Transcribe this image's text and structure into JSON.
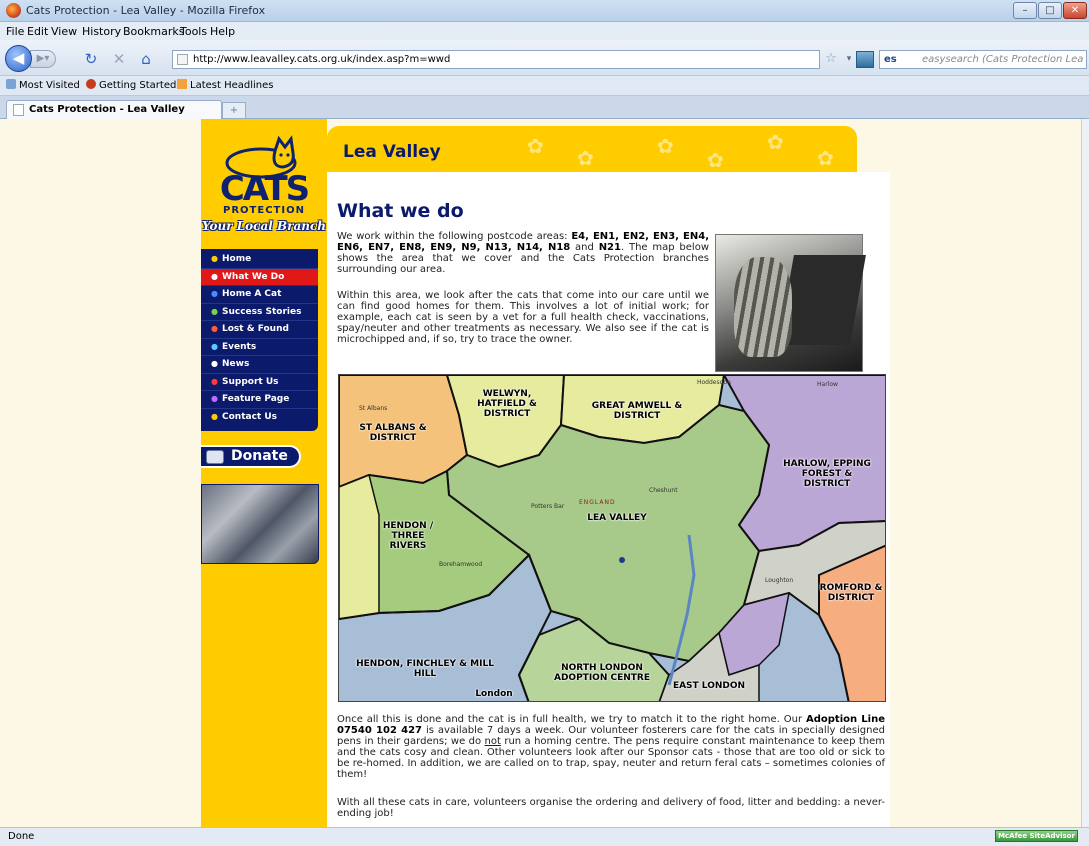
{
  "browser": {
    "window_title": "Cats Protection - Lea Valley - Mozilla Firefox",
    "menu": [
      "File",
      "Edit",
      "View",
      "History",
      "Bookmarks",
      "Tools",
      "Help"
    ],
    "url": "http://www.leavalley.cats.org.uk/index.asp?m=wwd",
    "search_placeholder": "easysearch (Cats Protection Lea Vall",
    "search_engine_label": "es",
    "bookmarks": [
      "Most Visited",
      "Getting Started",
      "Latest Headlines"
    ],
    "tab_title": "Cats Protection - Lea Valley",
    "new_tab": "+",
    "status": "Done",
    "addon": "McAfee SiteAdvisor"
  },
  "site": {
    "logo_text": "CATS",
    "logo_sub": "PROTECTION",
    "logo_tagline": "Your Local Branch",
    "banner_title": "Lea Valley",
    "nav": [
      "Home",
      "What We Do",
      "Home A Cat",
      "Success Stories",
      "Lost & Found",
      "Events",
      "News",
      "Support Us",
      "Feature Page",
      "Contact Us"
    ],
    "nav_active_index": 1,
    "donate_label": "Donate"
  },
  "content": {
    "heading": "What we do",
    "p1_a": "We work within the following postcode areas: ",
    "p1_codes": "E4, EN1, EN2, EN3, EN4, EN6, EN7, EN8, EN9, N9, N13, N14, N18",
    "p1_and": " and ",
    "p1_last": "N21",
    "p1_b": ". The map below shows the area that we cover and the Cats Protection branches surrounding our area.",
    "p2": "Within this area, we look after the cats that come into our care until we can find good homes for them. This involves a lot of initial work; for example, each cat is seen by a vet for a full health check, vaccinations, spay/neuter and other treatments as necessary. We also see if the cat is microchipped and, if so, try to trace the owner.",
    "p3_a": "Once all this is done and the cat is in full health, we try to match it to the right home. Our ",
    "p3_bold": "Adoption Line 07540 102 427",
    "p3_b": " is available 7 days a week. Our volunteer fosterers care for the cats in specially designed pens in their gardens; we do ",
    "p3_not": "not",
    "p3_c": " run a homing centre. The pens require constant maintenance to keep them and the cats cosy and clean. Other volunteers look after our Sponsor cats - those that are too old or sick to be re-homed. In addition, we are called on to trap, spay, neuter and return feral cats – sometimes colonies of them!",
    "p4": "With all these cats in care, volunteers organise the ordering and delivery of food, litter and bedding: a never-ending job!"
  },
  "map": {
    "regions": {
      "st_albans": "ST ALBANS & DISTRICT",
      "welwyn": "WELWYN, HATFIELD & DISTRICT",
      "great_amwell": "GREAT AMWELL & DISTRICT",
      "harlow": "HARLOW, EPPING FOREST & DISTRICT",
      "lea_valley": "LEA VALLEY",
      "hendon_three": "HENDON / THREE RIVERS",
      "romford": "ROMFORD & DISTRICT",
      "hendon_finchley": "HENDON, FINCHLEY & MILL HILL",
      "north_london": "NORTH LONDON ADOPTION CENTRE",
      "east_london": "EAST LONDON",
      "london": "London"
    },
    "places": [
      "St Albans",
      "Potters Bar",
      "Cheshunt",
      "Borehamwood",
      "Loughton",
      "Harlow",
      "Hoddesdon",
      "ENGLAND"
    ],
    "colors": {
      "st_albans": "#f4c27a",
      "welwyn": "#e6eb9e",
      "harlow": "#bba7d6",
      "lea_valley": "#a7c98a",
      "hendon_three": "#a5cc7e",
      "romford": "#f6ad80",
      "london_blue": "#a8bdd6",
      "north_london": "#b7d49a",
      "grey": "#d0d1c9"
    }
  }
}
